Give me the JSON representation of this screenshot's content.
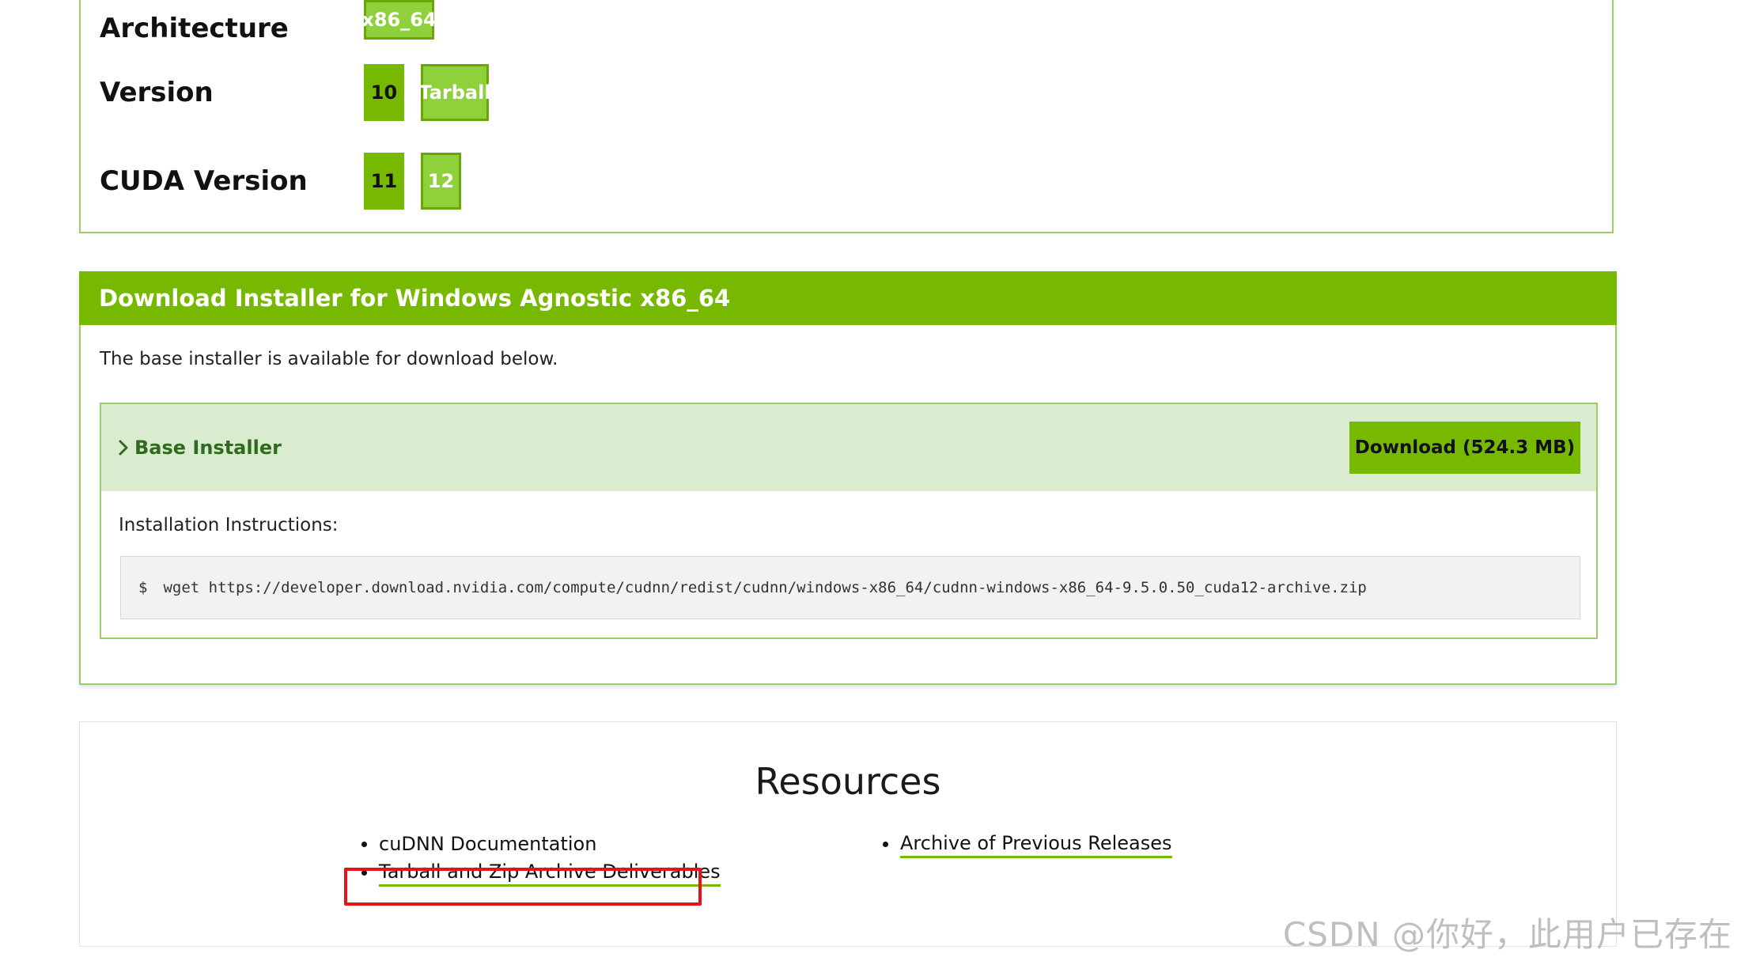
{
  "selector": {
    "architecture": {
      "label": "Architecture",
      "options": [
        "x86_64"
      ]
    },
    "version": {
      "label": "Version",
      "options": [
        "10",
        "Tarball"
      ]
    },
    "cuda_version": {
      "label": "CUDA Version",
      "options": [
        "11",
        "12"
      ]
    }
  },
  "download": {
    "title": "Download Installer for Windows Agnostic x86_64",
    "description": "The base installer is available for download below.",
    "installer": {
      "label": "Base Installer",
      "button_label": "Download (524.3 MB)",
      "instructions_label": "Installation Instructions:",
      "command_prompt": "$",
      "command": "wget https://developer.download.nvidia.com/compute/cudnn/redist/cudnn/windows-x86_64/cudnn-windows-x86_64-9.5.0.50_cuda12-archive.zip"
    }
  },
  "resources": {
    "title": "Resources",
    "left_links": [
      "cuDNN Documentation",
      "Tarball and Zip Archive Deliverables"
    ],
    "right_links": [
      "Archive of Previous Releases"
    ]
  },
  "watermark": "CSDN @你好，此用户已存在",
  "colors": {
    "accent": "#76b900",
    "accent_light": "#8ed13a",
    "installer_header_bg": "#d9ecd0",
    "highlight": "#e5141b"
  }
}
